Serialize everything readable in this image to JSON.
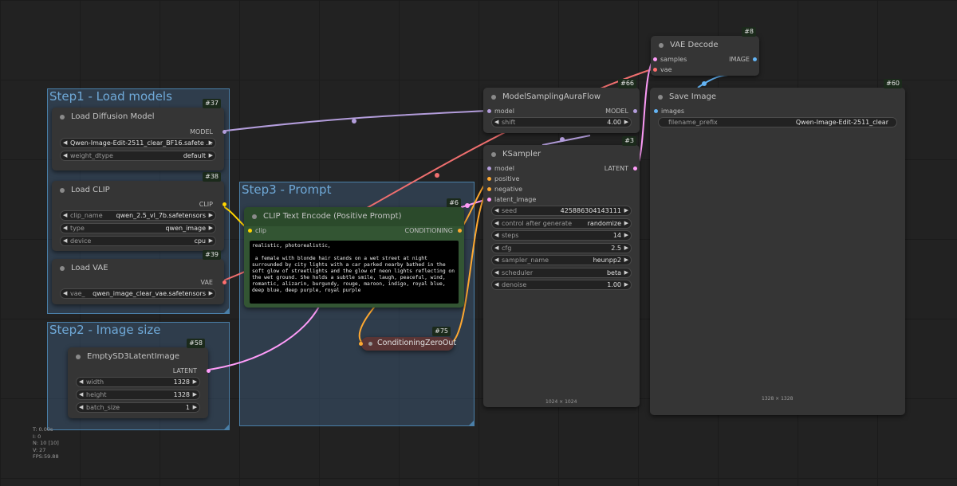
{
  "groups": {
    "step1": "Step1 - Load models",
    "step2": "Step2 - Image size",
    "step3": "Step3 - Prompt"
  },
  "colors": {
    "model": "#b39ddb",
    "clip": "#ffd500",
    "vae": "#ff6e6e",
    "conditioning": "#ffa931",
    "latent": "#ff9cf9",
    "image": "#64b5f6"
  },
  "nodes": {
    "load_diffusion": {
      "badge": "#37",
      "title": "Load Diffusion Model",
      "out_model": "MODEL",
      "unet_value": "Qwen-Image-Edit-2511_clear_BF16.safete ...",
      "weight_label": "weight_dtype",
      "weight_value": "default"
    },
    "load_clip": {
      "badge": "#38",
      "title": "Load CLIP",
      "out_clip": "CLIP",
      "clip_name_label": "clip_name",
      "clip_name_value": "qwen_2.5_vl_7b.safetensors",
      "type_label": "type",
      "type_value": "qwen_image",
      "device_label": "device",
      "device_value": "cpu"
    },
    "load_vae": {
      "badge": "#39",
      "title": "Load VAE",
      "out_vae": "VAE",
      "vae_label": "vae_",
      "vae_value": "qwen_image_clear_vae.safetensors"
    },
    "empty_latent": {
      "badge": "#58",
      "title": "EmptySD3LatentImage",
      "out_latent": "LATENT",
      "width_label": "width",
      "width_value": "1328",
      "height_label": "height",
      "height_value": "1328",
      "batch_label": "batch_size",
      "batch_value": "1"
    },
    "clip_text": {
      "badge": "#6",
      "title": "CLIP Text Encode (Positive Prompt)",
      "in_clip": "clip",
      "out_cond": "CONDITIONING",
      "prompt": "realistic, photorealistic,\n\n a female with blonde hair stands on a wet street at night surrounded by city lights with a car parked nearby bathed in the soft glow of streetlights and the glow of neon lights reflecting on the wet ground. She holds a subtle smile, laugh, peaceful, wind, romantic, alizarin, burgundy, rouge, maroon, indigo, royal blue, deep blue, deep purple, royal purple"
    },
    "cond_zero": {
      "badge": "#75",
      "title": "ConditioningZeroOut"
    },
    "model_sampling": {
      "badge": "#66",
      "title": "ModelSamplingAuraFlow",
      "in_model": "model",
      "out_model": "MODEL",
      "shift_label": "shift",
      "shift_value": "4.00"
    },
    "ksampler": {
      "badge": "#3",
      "title": "KSampler",
      "in_model": "model",
      "in_positive": "positive",
      "in_negative": "negative",
      "in_latent": "latent_image",
      "out_latent": "LATENT",
      "seed_label": "seed",
      "seed_value": "425886304143111",
      "control_label": "control after generate",
      "control_value": "randomize",
      "steps_label": "steps",
      "steps_value": "14",
      "cfg_label": "cfg",
      "cfg_value": "2.5",
      "sampler_label": "sampler_name",
      "sampler_value": "heunpp2",
      "scheduler_label": "scheduler",
      "scheduler_value": "beta",
      "denoise_label": "denoise",
      "denoise_value": "1.00",
      "footer": "1024 × 1024"
    },
    "vae_decode": {
      "badge": "#8",
      "title": "VAE Decode",
      "in_samples": "samples",
      "in_vae": "vae",
      "out_image": "IMAGE"
    },
    "save_image": {
      "badge": "#60",
      "title": "Save Image",
      "in_images": "images",
      "prefix_label": "filename_prefix",
      "prefix_value": "Qwen-Image-Edit-2511_clear",
      "footer": "1328 × 1328"
    }
  },
  "stats": {
    "t": "T: 0.00s",
    "i": "I: 0",
    "n": "N: 10 [10]",
    "v": "V: 27",
    "fps": "FPS:59.88"
  }
}
